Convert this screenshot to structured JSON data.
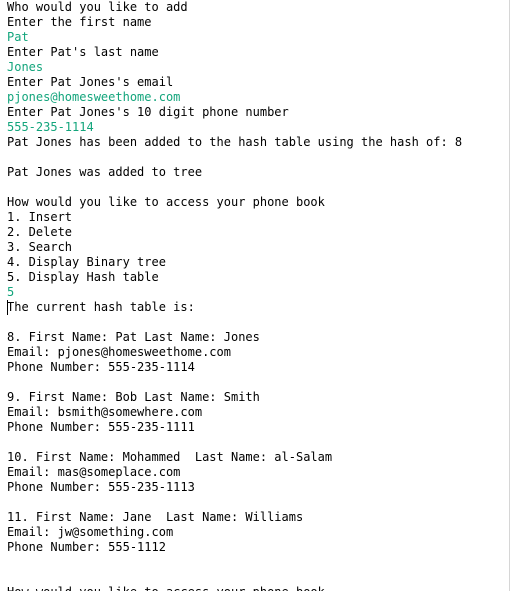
{
  "console": {
    "lines": [
      {
        "text": "Who would you like to add",
        "kind": "output"
      },
      {
        "text": "Enter the first name",
        "kind": "output"
      },
      {
        "text": "Pat",
        "kind": "input"
      },
      {
        "text": "Enter Pat's last name",
        "kind": "output"
      },
      {
        "text": "Jones",
        "kind": "input"
      },
      {
        "text": "Enter Pat Jones's email",
        "kind": "output"
      },
      {
        "text": "pjones@homesweethome.com",
        "kind": "input"
      },
      {
        "text": "Enter Pat Jones's 10 digit phone number",
        "kind": "output"
      },
      {
        "text": "555-235-1114",
        "kind": "input"
      },
      {
        "text": "Pat Jones has been added to the hash table using the hash of: 8",
        "kind": "output"
      },
      {
        "text": "",
        "kind": "output"
      },
      {
        "text": "Pat Jones was added to tree",
        "kind": "output"
      },
      {
        "text": "",
        "kind": "output"
      },
      {
        "text": "How would you like to access your phone book",
        "kind": "output"
      },
      {
        "text": "1. Insert",
        "kind": "output"
      },
      {
        "text": "2. Delete",
        "kind": "output"
      },
      {
        "text": "3. Search",
        "kind": "output"
      },
      {
        "text": "4. Display Binary tree",
        "kind": "output"
      },
      {
        "text": "5. Display Hash table",
        "kind": "output"
      },
      {
        "text": "5",
        "kind": "input"
      },
      {
        "text": "The current hash table is:",
        "kind": "output"
      },
      {
        "text": "",
        "kind": "output"
      },
      {
        "text": "8. First Name: Pat Last Name: Jones",
        "kind": "output"
      },
      {
        "text": "Email: pjones@homesweethome.com",
        "kind": "output"
      },
      {
        "text": "Phone Number: 555-235-1114",
        "kind": "output"
      },
      {
        "text": "",
        "kind": "output"
      },
      {
        "text": "9. First Name: Bob Last Name: Smith",
        "kind": "output"
      },
      {
        "text": "Email: bsmith@somewhere.com",
        "kind": "output"
      },
      {
        "text": "Phone Number: 555-235-1111",
        "kind": "output"
      },
      {
        "text": "",
        "kind": "output"
      },
      {
        "text": "10. First Name: Mohammed  Last Name: al-Salam",
        "kind": "output"
      },
      {
        "text": "Email: mas@someplace.com",
        "kind": "output"
      },
      {
        "text": "Phone Number: 555-235-1113",
        "kind": "output"
      },
      {
        "text": "",
        "kind": "output"
      },
      {
        "text": "11. First Name: Jane  Last Name: Williams",
        "kind": "output"
      },
      {
        "text": "Email: jw@something.com",
        "kind": "output"
      },
      {
        "text": "Phone Number: 555-1112",
        "kind": "output"
      },
      {
        "text": "",
        "kind": "output"
      },
      {
        "text": "",
        "kind": "output"
      },
      {
        "text": "How would you like to access your phone book",
        "kind": "output"
      }
    ]
  },
  "colors": {
    "output": "#000000",
    "input": "#13a57c",
    "background": "#ffffff"
  }
}
